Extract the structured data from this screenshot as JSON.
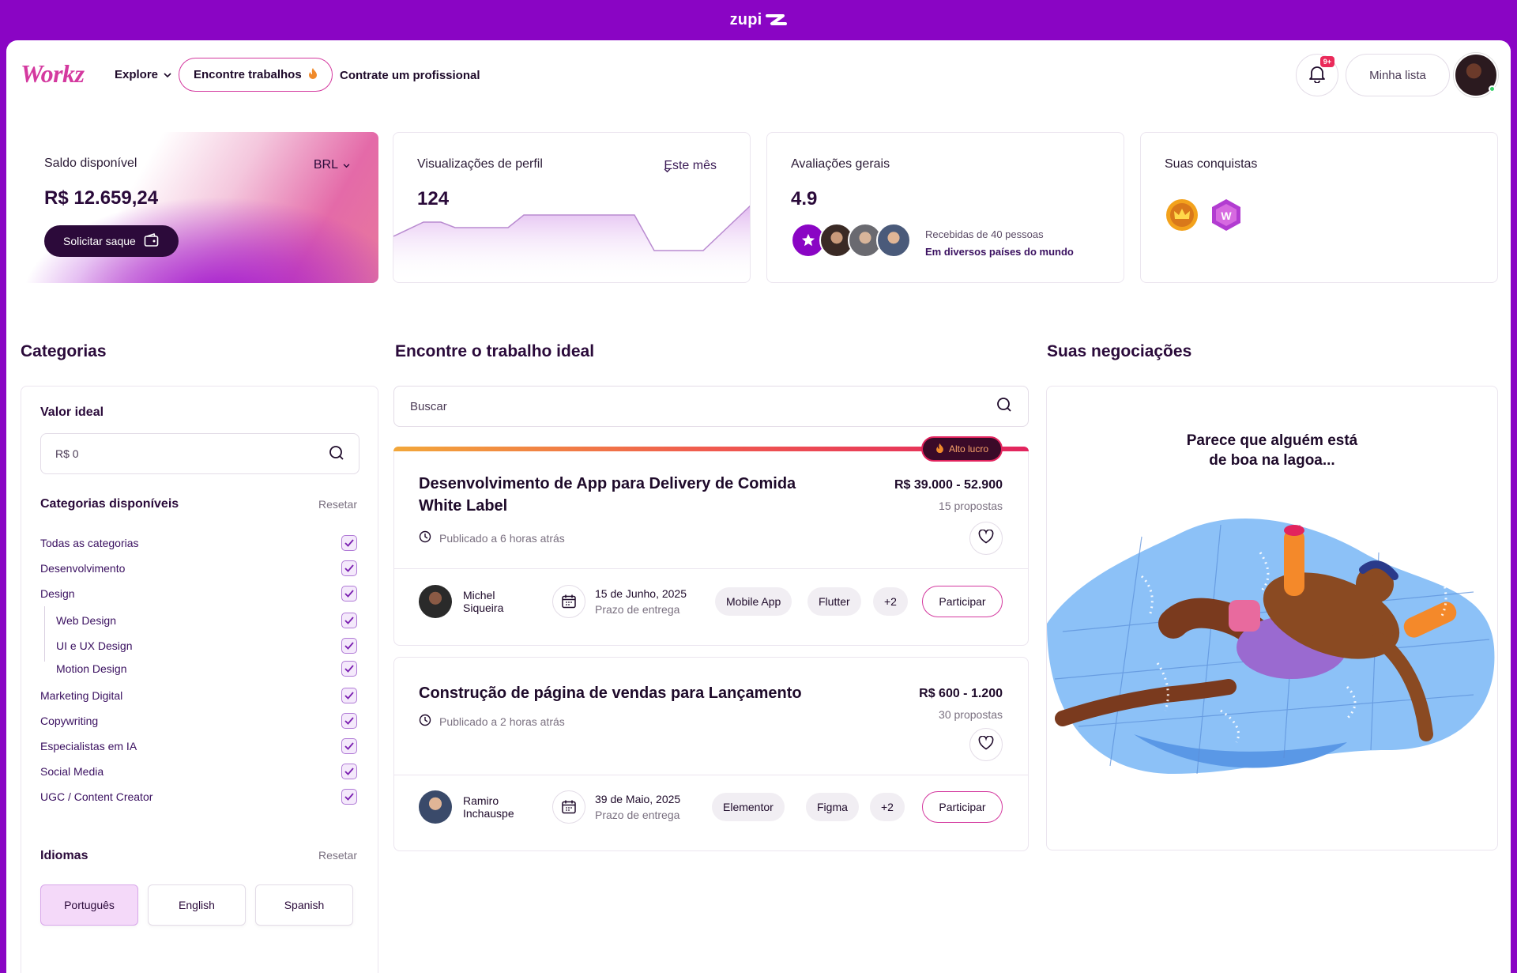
{
  "topbar": {
    "brand": "zupi"
  },
  "header": {
    "logo": "Workz",
    "nav_explore": "Explore",
    "nav_find_jobs": "Encontre trabalhos",
    "nav_hire": "Contrate um profissional",
    "notifications_badge": "9+",
    "my_list": "Minha lista"
  },
  "stats": {
    "balance": {
      "label": "Saldo disponível",
      "currency": "BRL",
      "value": "R$ 12.659,24",
      "button": "Solicitar saque"
    },
    "views": {
      "label": "Visualizações de perfil",
      "period": "Este mês",
      "value": "124"
    },
    "ratings": {
      "label": "Avaliações gerais",
      "value": "4.9",
      "line1": "Recebidas de 40 pessoas",
      "line2": "Em diversos países do mundo"
    },
    "achievements": {
      "label": "Suas conquistas",
      "icons": [
        "crown-medal-icon",
        "w-gem-icon"
      ]
    }
  },
  "sections": {
    "categories": "Categorias",
    "jobs": "Encontre o trabalho ideal",
    "negotiations": "Suas negociações"
  },
  "filters": {
    "ideal_value_label": "Valor ideal",
    "ideal_value_placeholder": "R$ 0",
    "available_categories_label": "Categorias disponíveis",
    "reset": "Resetar",
    "categories": [
      {
        "label": "Todas as categorias",
        "checked": true
      },
      {
        "label": "Desenvolvimento",
        "checked": true
      },
      {
        "label": "Design",
        "checked": true
      },
      {
        "label": "Web Design",
        "checked": true,
        "sub": true
      },
      {
        "label": "UI e UX Design",
        "checked": true,
        "sub": true
      },
      {
        "label": "Motion Design",
        "checked": true,
        "sub": true
      },
      {
        "label": "Marketing Digital",
        "checked": true
      },
      {
        "label": "Copywriting",
        "checked": true
      },
      {
        "label": "Especialistas em IA",
        "checked": true
      },
      {
        "label": "Social Media",
        "checked": true
      },
      {
        "label": "UGC / Content Creator",
        "checked": true
      }
    ],
    "languages_label": "Idiomas",
    "languages": [
      "Português",
      "English",
      "Spanish"
    ],
    "language_selected": "Português"
  },
  "search": {
    "placeholder": "Buscar"
  },
  "jobs": [
    {
      "badge": "Alto lucro",
      "title": "Desenvolvimento de App para Delivery de Comida White Label",
      "price": "R$ 39.000 - 52.900",
      "proposals": "15 propostas",
      "posted": "Publicado a 6 horas atrás",
      "client_first": "Michel",
      "client_last": "Siqueira",
      "date": "15 de Junho, 2025",
      "date_label": "Prazo de entrega",
      "tags": [
        "Mobile App",
        "Flutter",
        "+2"
      ],
      "cta": "Participar"
    },
    {
      "title": "Construção de página de vendas para Lançamento",
      "price": "R$ 600 - 1.200",
      "proposals": "30 propostas",
      "posted": "Publicado a 2 horas atrás",
      "client_first": "Ramiro",
      "client_last": "Inchauspe",
      "date": "39 de Maio, 2025",
      "date_label": "Prazo de entrega",
      "tags": [
        "Elementor",
        "Figma",
        "+2"
      ],
      "cta": "Participar"
    }
  ],
  "negotiations": {
    "empty_line1": "Parece que alguém está",
    "empty_line2": "de boa na lagoa..."
  },
  "colors": {
    "brand_purple": "#8a05c4",
    "accent_pink": "#d4399f",
    "dark": "#2c0a3a"
  }
}
